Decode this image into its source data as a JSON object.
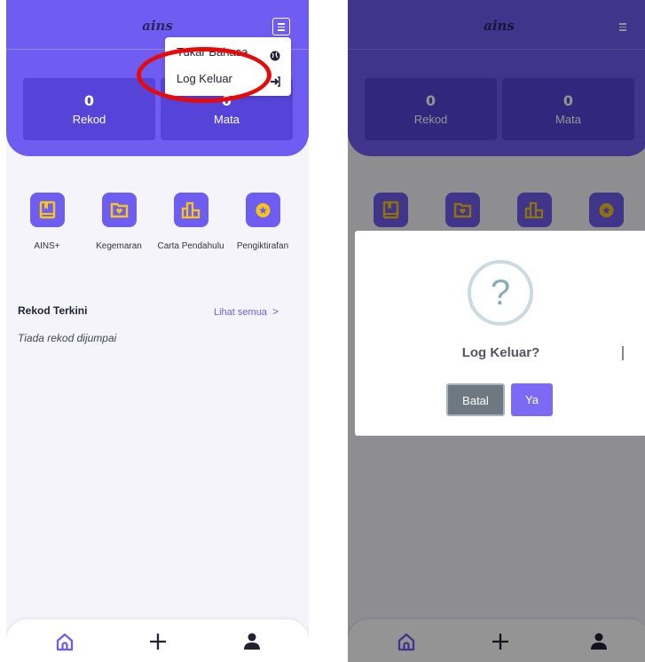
{
  "app": {
    "logo": "ains"
  },
  "stats": [
    {
      "value": "0",
      "label": "Rekod"
    },
    {
      "value": "0",
      "label": "Mata"
    }
  ],
  "quick_actions": [
    {
      "label": "AINS+",
      "icon": "book-icon"
    },
    {
      "label": "Kegemaran",
      "icon": "folder-heart-icon"
    },
    {
      "label": "Carta Pendahulu",
      "icon": "leaderboard-icon"
    },
    {
      "label": "Pengiktirafan",
      "icon": "star-badge-icon"
    }
  ],
  "recent": {
    "title": "Rekod Terkini",
    "see_all": "Lihat semua",
    "chevron": ">",
    "empty": "Tiada rekod dijumpai"
  },
  "dropdown": {
    "items": [
      {
        "label": "Tukar Bahasa",
        "icon": "globe-icon"
      },
      {
        "label": "Log Keluar",
        "icon": "logout-icon"
      }
    ]
  },
  "dialog": {
    "icon_glyph": "?",
    "title": "Log Keluar?",
    "cancel_label": "Batal",
    "confirm_label": "Ya"
  },
  "bottom_nav": [
    {
      "icon": "home-icon"
    },
    {
      "icon": "plus-icon"
    },
    {
      "icon": "user-icon"
    }
  ],
  "colors": {
    "primary": "#6f5cf0",
    "stat_bg": "#5643d8",
    "icon_yellow": "#f5c518",
    "highlight_ring": "#e60a0a"
  }
}
